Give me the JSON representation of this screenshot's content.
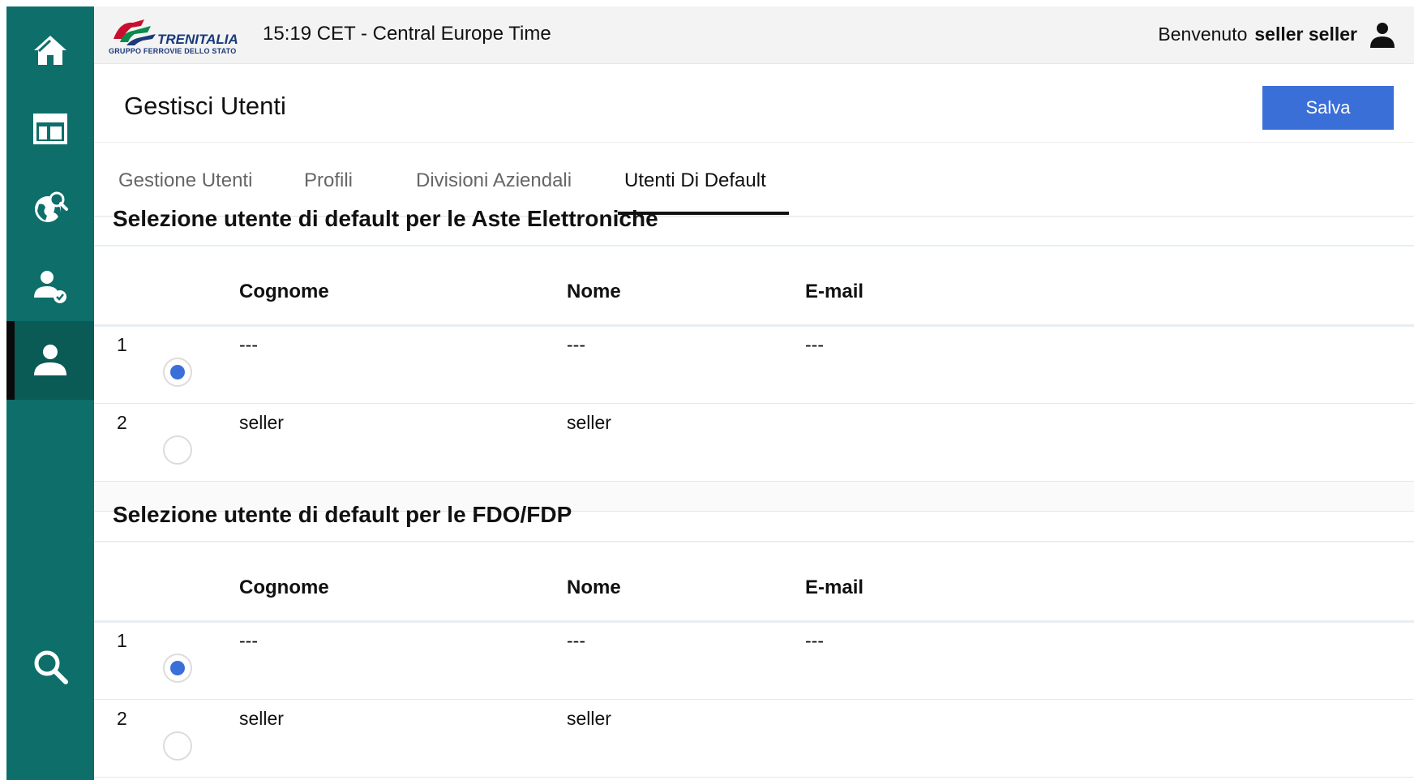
{
  "topbar": {
    "brand": "TRENITALIA",
    "brand_sub": "GRUPPO FERROVIE DELLO STATO",
    "clock": "15:19 CET - Central Europe Time",
    "welcome_label": "Benvenuto",
    "user_name": "seller seller"
  },
  "sidebar": {
    "items": [
      {
        "name": "home",
        "icon": "home-icon"
      },
      {
        "name": "dashboard",
        "icon": "layout-icon"
      },
      {
        "name": "global-search",
        "icon": "globe-search-icon"
      },
      {
        "name": "user-approve",
        "icon": "user-check-icon"
      },
      {
        "name": "users",
        "icon": "user-icon",
        "active": true
      },
      {
        "name": "search",
        "icon": "search-icon"
      }
    ]
  },
  "header": {
    "title": "Gestisci Utenti",
    "save_label": "Salva"
  },
  "tabs": [
    {
      "label": "Gestione Utenti"
    },
    {
      "label": "Profili"
    },
    {
      "label": "Divisioni Aziendali"
    },
    {
      "label": "Utenti Di Default",
      "active": true
    }
  ],
  "sections": [
    {
      "title": "Selezione utente di default per le Aste Elettroniche",
      "columns": [
        "Cognome",
        "Nome",
        "E-mail"
      ],
      "rows": [
        {
          "index": "1",
          "cognome": "---",
          "nome": "---",
          "email": "---",
          "selected": true
        },
        {
          "index": "2",
          "cognome": "seller",
          "nome": "seller",
          "email": "",
          "selected": false
        }
      ]
    },
    {
      "title": "Selezione utente di default per le FDO/FDP",
      "columns": [
        "Cognome",
        "Nome",
        "E-mail"
      ],
      "rows": [
        {
          "index": "1",
          "cognome": "---",
          "nome": "---",
          "email": "---",
          "selected": true
        },
        {
          "index": "2",
          "cognome": "seller",
          "nome": "seller",
          "email": "",
          "selected": false
        }
      ]
    }
  ],
  "colors": {
    "sidebar": "#0d6e6a",
    "sidebar_active": "#0a5a56",
    "accent": "#3b6fd8",
    "brand_red": "#c8102e",
    "brand_green": "#0b8a4a",
    "brand_blue": "#1a3a7a"
  }
}
